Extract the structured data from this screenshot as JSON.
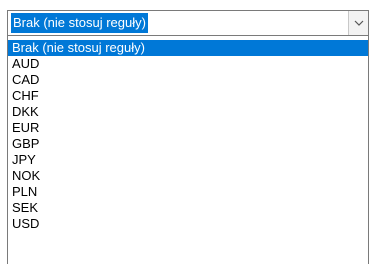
{
  "combo": {
    "selected_value": "Brak (nie stosuj reguły)",
    "button_icon": "chevron-down-icon"
  },
  "dropdown": {
    "options": [
      "Brak (nie stosuj reguły)",
      "AUD",
      "CAD",
      "CHF",
      "DKK",
      "EUR",
      "GBP",
      "JPY",
      "NOK",
      "PLN",
      "SEK",
      "USD"
    ],
    "highlighted_option": "Brak (nie stosuj reguły)"
  },
  "colors": {
    "selection": "#0078d7",
    "border": "#7a7a7a"
  }
}
